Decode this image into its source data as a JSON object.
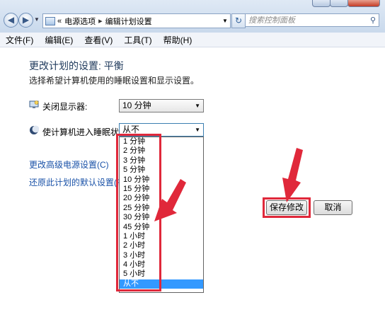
{
  "window": {
    "controls": [
      "minimize",
      "maximize",
      "close"
    ]
  },
  "address": {
    "prefix": "«",
    "crumb1": "电源选项",
    "crumb2": "编辑计划设置",
    "search_placeholder": "搜索控制面板"
  },
  "menu": [
    "文件(F)",
    "编辑(E)",
    "查看(V)",
    "工具(T)",
    "帮助(H)"
  ],
  "page": {
    "title": "更改计划的设置: 平衡",
    "subtitle": "选择希望计算机使用的睡眠设置和显示设置。",
    "display_label": "关闭显示器:",
    "display_value": "10 分钟",
    "sleep_label": "使计算机进入睡眠状态:",
    "sleep_value": "从不",
    "link_advanced": "更改高级电源设置(C)",
    "link_restore": "还原此计划的默认设置(R)",
    "save_button": "保存修改",
    "cancel_button": "取消"
  },
  "sleep_options": [
    "1 分钟",
    "2 分钟",
    "3 分钟",
    "5 分钟",
    "10 分钟",
    "15 分钟",
    "20 分钟",
    "25 分钟",
    "30 分钟",
    "45 分钟",
    "1 小时",
    "2 小时",
    "3 小时",
    "4 小时",
    "5 小时",
    "从不"
  ],
  "sleep_selected_index": 15,
  "colors": {
    "highlight": "#e0283a",
    "selection": "#3399ff",
    "link": "#1a52a8"
  }
}
